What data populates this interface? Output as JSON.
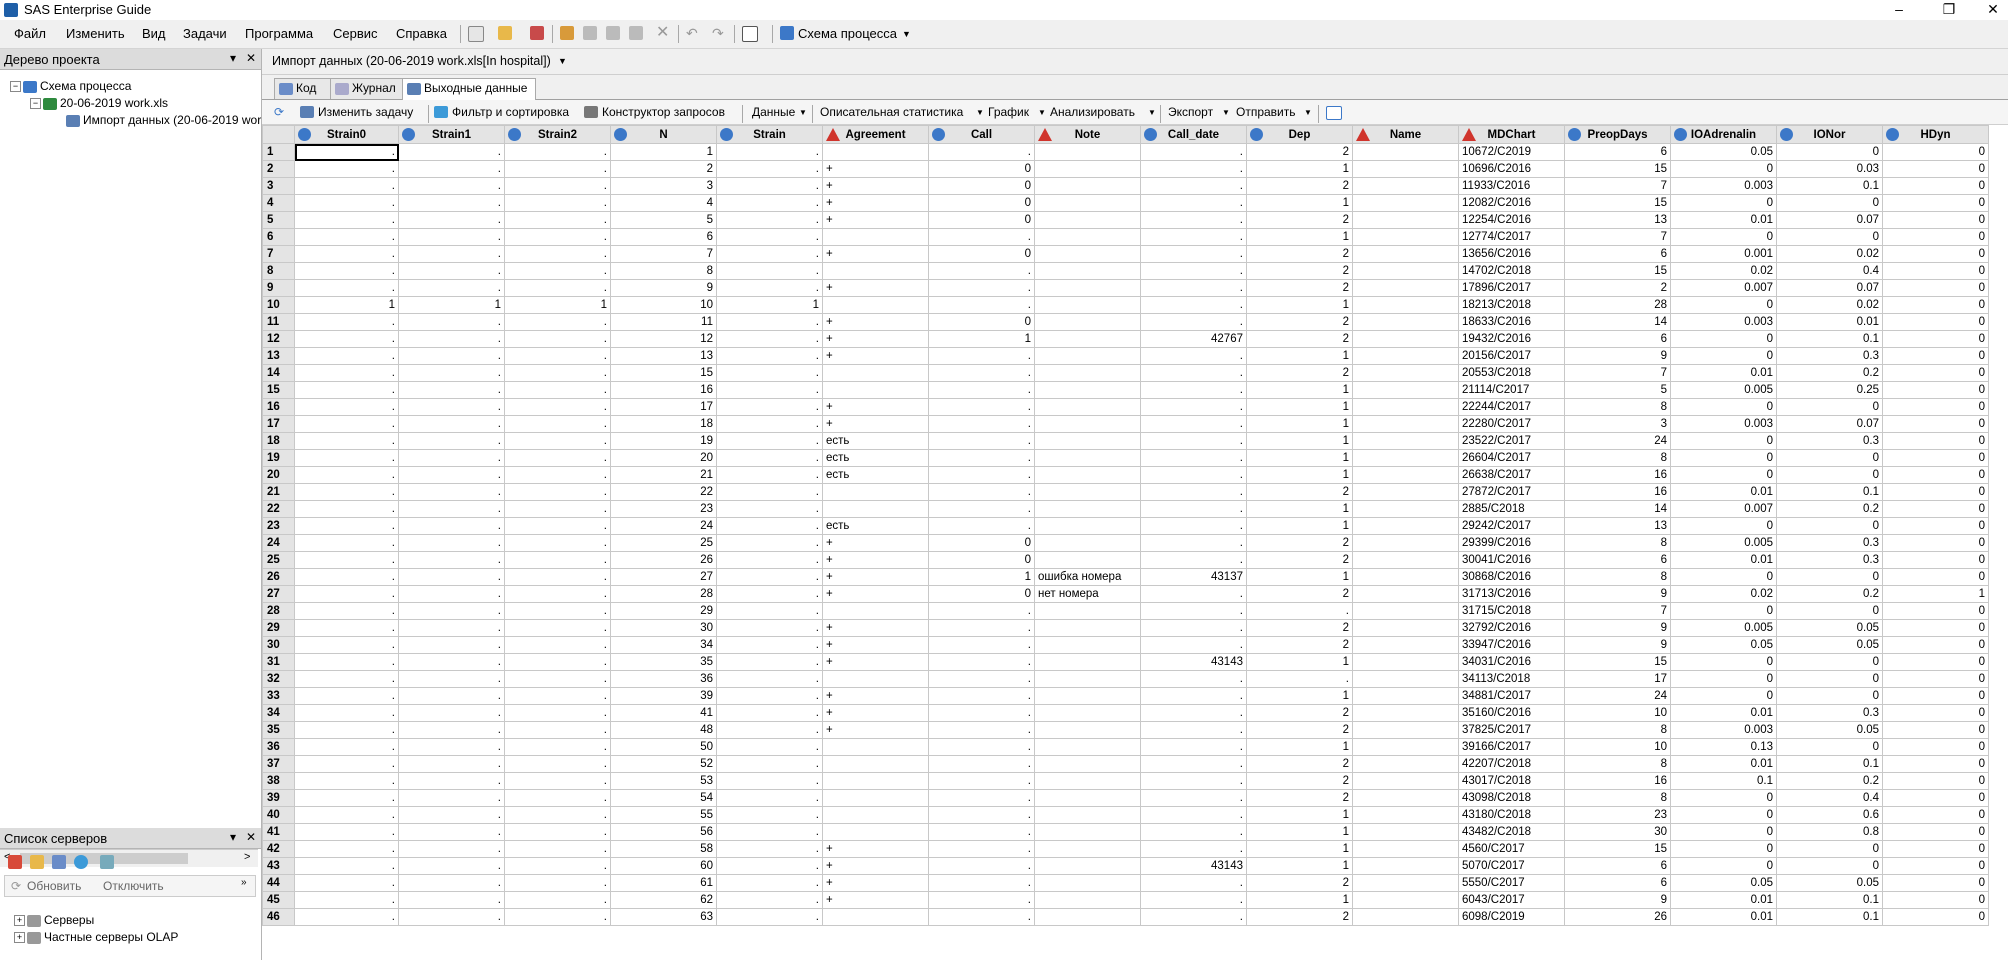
{
  "window": {
    "title": "SAS Enterprise Guide",
    "min": "–",
    "max": "❐",
    "close": "✕"
  },
  "menu": [
    "Файл",
    "Изменить",
    "Вид",
    "Задачи",
    "Программа",
    "Сервис",
    "Справка"
  ],
  "toolbar": {
    "process_flow": "Схема процесса"
  },
  "project_tree": {
    "title": "Дерево проекта",
    "items": [
      "Схема процесса",
      "20-06-2019 work.xls",
      "Импорт данных (20-06-2019 work"
    ]
  },
  "server_list": {
    "title": "Список серверов",
    "refresh": "Обновить",
    "disconnect": "Отключить",
    "items": [
      "Серверы",
      "Частные серверы OLAP"
    ]
  },
  "document": {
    "title": "Импорт данных (20-06-2019 work.xls[In hospital])"
  },
  "tabs": [
    "Код",
    "Журнал",
    "Выходные данные"
  ],
  "data_toolbar": {
    "modify": "Изменить задачу",
    "filter": "Фильтр и сортировка",
    "query": "Конструктор запросов",
    "data": "Данные",
    "stats": "Описательная статистика",
    "graph": "График",
    "analyze": "Анализировать",
    "export": "Экспорт",
    "send": "Отправить"
  },
  "grid": {
    "columns": [
      {
        "name": "Strain0",
        "type": "num"
      },
      {
        "name": "Strain1",
        "type": "num"
      },
      {
        "name": "Strain2",
        "type": "num"
      },
      {
        "name": "N",
        "type": "num"
      },
      {
        "name": "Strain",
        "type": "num"
      },
      {
        "name": "Agreement",
        "type": "chr"
      },
      {
        "name": "Call",
        "type": "num"
      },
      {
        "name": "Note",
        "type": "chr"
      },
      {
        "name": "Call_date",
        "type": "num"
      },
      {
        "name": "Dep",
        "type": "num"
      },
      {
        "name": "Name",
        "type": "chr"
      },
      {
        "name": "MDChart",
        "type": "chr"
      },
      {
        "name": "PreopDays",
        "type": "num"
      },
      {
        "name": "IOAdrenalin",
        "type": "num"
      },
      {
        "name": "IONor",
        "type": "num"
      },
      {
        "name": "HDyn",
        "type": "num"
      }
    ],
    "rows": [
      [
        ".",
        ".",
        ".",
        "1",
        ".",
        "",
        ".",
        "",
        ".",
        "2",
        "",
        "10672/C2019",
        "6",
        "0.05",
        "0",
        "0"
      ],
      [
        ".",
        ".",
        ".",
        "2",
        ".",
        "+",
        "0",
        "",
        ".",
        "1",
        "",
        "10696/C2016",
        "15",
        "0",
        "0.03",
        "0"
      ],
      [
        ".",
        ".",
        ".",
        "3",
        ".",
        "+",
        "0",
        "",
        ".",
        "2",
        "",
        "11933/C2016",
        "7",
        "0.003",
        "0.1",
        "0"
      ],
      [
        ".",
        ".",
        ".",
        "4",
        ".",
        "+",
        "0",
        "",
        ".",
        "1",
        "",
        "12082/C2016",
        "15",
        "0",
        "0",
        "0"
      ],
      [
        ".",
        ".",
        ".",
        "5",
        ".",
        "+",
        "0",
        "",
        ".",
        "2",
        "",
        "12254/C2016",
        "13",
        "0.01",
        "0.07",
        "0"
      ],
      [
        ".",
        ".",
        ".",
        "6",
        ".",
        "",
        ".",
        "",
        ".",
        "1",
        "",
        "12774/C2017",
        "7",
        "0",
        "0",
        "0"
      ],
      [
        ".",
        ".",
        ".",
        "7",
        ".",
        "+",
        "0",
        "",
        ".",
        "2",
        "",
        "13656/C2016",
        "6",
        "0.001",
        "0.02",
        "0"
      ],
      [
        ".",
        ".",
        ".",
        "8",
        ".",
        "",
        ".",
        "",
        ".",
        "2",
        "",
        "14702/C2018",
        "15",
        "0.02",
        "0.4",
        "0"
      ],
      [
        ".",
        ".",
        ".",
        "9",
        ".",
        "+",
        ".",
        "",
        ".",
        "2",
        "",
        "17896/C2017",
        "2",
        "0.007",
        "0.07",
        "0"
      ],
      [
        "1",
        "1",
        "1",
        "10",
        "1",
        "",
        ".",
        "",
        ".",
        "1",
        "",
        "18213/C2018",
        "28",
        "0",
        "0.02",
        "0"
      ],
      [
        ".",
        ".",
        ".",
        "11",
        ".",
        "+",
        "0",
        "",
        ".",
        "2",
        "",
        "18633/C2016",
        "14",
        "0.003",
        "0.01",
        "0"
      ],
      [
        ".",
        ".",
        ".",
        "12",
        ".",
        "+",
        "1",
        "",
        "42767",
        "2",
        "",
        "19432/C2016",
        "6",
        "0",
        "0.1",
        "0"
      ],
      [
        ".",
        ".",
        ".",
        "13",
        ".",
        "+",
        ".",
        "",
        ".",
        "1",
        "",
        "20156/C2017",
        "9",
        "0",
        "0.3",
        "0"
      ],
      [
        ".",
        ".",
        ".",
        "15",
        ".",
        "",
        ".",
        "",
        ".",
        "2",
        "",
        "20553/C2018",
        "7",
        "0.01",
        "0.2",
        "0"
      ],
      [
        ".",
        ".",
        ".",
        "16",
        ".",
        "",
        ".",
        "",
        ".",
        "1",
        "",
        "21114/C2017",
        "5",
        "0.005",
        "0.25",
        "0"
      ],
      [
        ".",
        ".",
        ".",
        "17",
        ".",
        "+",
        ".",
        "",
        ".",
        "1",
        "",
        "22244/C2017",
        "8",
        "0",
        "0",
        "0"
      ],
      [
        ".",
        ".",
        ".",
        "18",
        ".",
        "+",
        ".",
        "",
        ".",
        "1",
        "",
        "22280/C2017",
        "3",
        "0.003",
        "0.07",
        "0"
      ],
      [
        ".",
        ".",
        ".",
        "19",
        ".",
        "есть",
        ".",
        "",
        ".",
        "1",
        "",
        "23522/C2017",
        "24",
        "0",
        "0.3",
        "0"
      ],
      [
        ".",
        ".",
        ".",
        "20",
        ".",
        "есть",
        ".",
        "",
        ".",
        "1",
        "",
        "26604/C2017",
        "8",
        "0",
        "0",
        "0"
      ],
      [
        ".",
        ".",
        ".",
        "21",
        ".",
        "есть",
        ".",
        "",
        ".",
        "1",
        "",
        "26638/C2017",
        "16",
        "0",
        "0",
        "0"
      ],
      [
        ".",
        ".",
        ".",
        "22",
        ".",
        "",
        ".",
        "",
        ".",
        "2",
        "",
        "27872/C2017",
        "16",
        "0.01",
        "0.1",
        "0"
      ],
      [
        ".",
        ".",
        ".",
        "23",
        ".",
        "",
        ".",
        "",
        ".",
        "1",
        "",
        "2885/C2018",
        "14",
        "0.007",
        "0.2",
        "0"
      ],
      [
        ".",
        ".",
        ".",
        "24",
        ".",
        "есть",
        ".",
        "",
        ".",
        "1",
        "",
        "29242/C2017",
        "13",
        "0",
        "0",
        "0"
      ],
      [
        ".",
        ".",
        ".",
        "25",
        ".",
        "+",
        "0",
        "",
        ".",
        "2",
        "",
        "29399/C2016",
        "8",
        "0.005",
        "0.3",
        "0"
      ],
      [
        ".",
        ".",
        ".",
        "26",
        ".",
        "+",
        "0",
        "",
        ".",
        "2",
        "",
        "30041/C2016",
        "6",
        "0.01",
        "0.3",
        "0"
      ],
      [
        ".",
        ".",
        ".",
        "27",
        ".",
        "+",
        "1",
        "ошибка номера",
        "43137",
        "1",
        "",
        "30868/C2016",
        "8",
        "0",
        "0",
        "0"
      ],
      [
        ".",
        ".",
        ".",
        "28",
        ".",
        "+",
        "0",
        "нет номера",
        ".",
        "2",
        "",
        "31713/C2016",
        "9",
        "0.02",
        "0.2",
        "1"
      ],
      [
        ".",
        ".",
        ".",
        "29",
        ".",
        "",
        ".",
        "",
        ".",
        ".",
        "",
        "31715/C2018",
        "7",
        "0",
        "0",
        "0"
      ],
      [
        ".",
        ".",
        ".",
        "30",
        ".",
        "+",
        ".",
        "",
        ".",
        "2",
        "",
        "32792/C2016",
        "9",
        "0.005",
        "0.05",
        "0"
      ],
      [
        ".",
        ".",
        ".",
        "34",
        ".",
        "+",
        ".",
        "",
        ".",
        "2",
        "",
        "33947/C2016",
        "9",
        "0.05",
        "0.05",
        "0"
      ],
      [
        ".",
        ".",
        ".",
        "35",
        ".",
        "+",
        ".",
        "",
        "43143",
        "1",
        "",
        "34031/C2016",
        "15",
        "0",
        "0",
        "0"
      ],
      [
        ".",
        ".",
        ".",
        "36",
        ".",
        "",
        ".",
        "",
        ".",
        ".",
        "",
        "34113/C2018",
        "17",
        "0",
        "0",
        "0"
      ],
      [
        ".",
        ".",
        ".",
        "39",
        ".",
        "+",
        ".",
        "",
        ".",
        "1",
        "",
        "34881/C2017",
        "24",
        "0",
        "0",
        "0"
      ],
      [
        ".",
        ".",
        ".",
        "41",
        ".",
        "+",
        ".",
        "",
        ".",
        "2",
        "",
        "35160/C2016",
        "10",
        "0.01",
        "0.3",
        "0"
      ],
      [
        ".",
        ".",
        ".",
        "48",
        ".",
        "+",
        ".",
        "",
        ".",
        "2",
        "",
        "37825/C2017",
        "8",
        "0.003",
        "0.05",
        "0"
      ],
      [
        ".",
        ".",
        ".",
        "50",
        ".",
        "",
        ".",
        "",
        ".",
        "1",
        "",
        "39166/C2017",
        "10",
        "0.13",
        "0",
        "0"
      ],
      [
        ".",
        ".",
        ".",
        "52",
        ".",
        "",
        ".",
        "",
        ".",
        "2",
        "",
        "42207/C2018",
        "8",
        "0.01",
        "0.1",
        "0"
      ],
      [
        ".",
        ".",
        ".",
        "53",
        ".",
        "",
        ".",
        "",
        ".",
        "2",
        "",
        "43017/C2018",
        "16",
        "0.1",
        "0.2",
        "0"
      ],
      [
        ".",
        ".",
        ".",
        "54",
        ".",
        "",
        ".",
        "",
        ".",
        "2",
        "",
        "43098/C2018",
        "8",
        "0",
        "0.4",
        "0"
      ],
      [
        ".",
        ".",
        ".",
        "55",
        ".",
        "",
        ".",
        "",
        ".",
        "1",
        "",
        "43180/C2018",
        "23",
        "0",
        "0.6",
        "0"
      ],
      [
        ".",
        ".",
        ".",
        "56",
        ".",
        "",
        ".",
        "",
        ".",
        "1",
        "",
        "43482/C2018",
        "30",
        "0",
        "0.8",
        "0"
      ],
      [
        ".",
        ".",
        ".",
        "58",
        ".",
        "+",
        ".",
        "",
        ".",
        "1",
        "",
        "4560/C2017",
        "15",
        "0",
        "0",
        "0"
      ],
      [
        ".",
        ".",
        ".",
        "60",
        ".",
        "+",
        ".",
        "",
        "43143",
        "1",
        "",
        "5070/C2017",
        "6",
        "0",
        "0",
        "0"
      ],
      [
        ".",
        ".",
        ".",
        "61",
        ".",
        "+",
        ".",
        "",
        ".",
        "2",
        "",
        "5550/C2017",
        "6",
        "0.05",
        "0.05",
        "0"
      ],
      [
        ".",
        ".",
        ".",
        "62",
        ".",
        "+",
        ".",
        "",
        ".",
        "1",
        "",
        "6043/C2017",
        "9",
        "0.01",
        "0.1",
        "0"
      ],
      [
        ".",
        ".",
        ".",
        "63",
        ".",
        "",
        ".",
        "",
        ".",
        "2",
        "",
        "6098/C2019",
        "26",
        "0.01",
        "0.1",
        "0"
      ]
    ]
  }
}
